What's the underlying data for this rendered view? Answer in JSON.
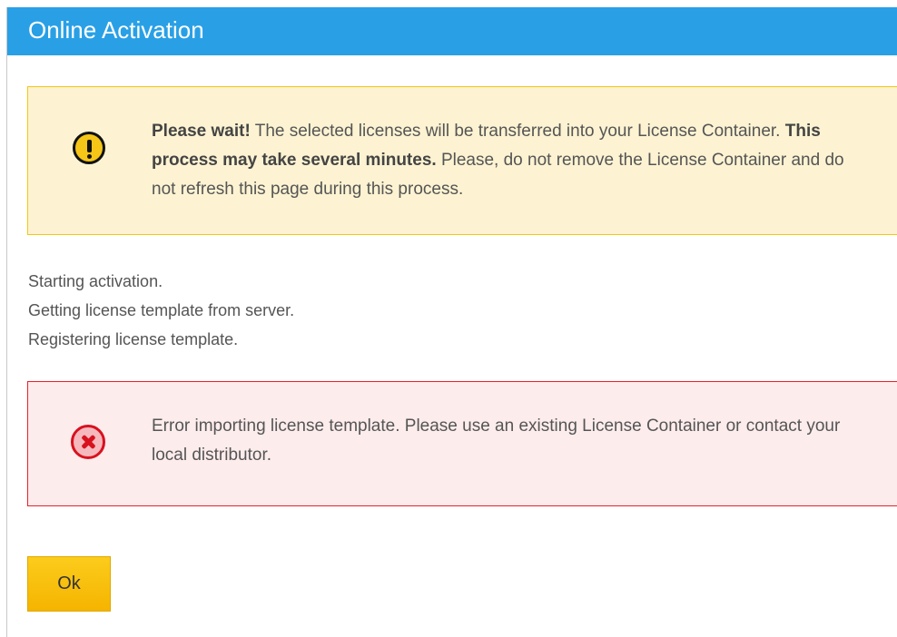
{
  "header": {
    "title": "Online Activation",
    "color": "#29a0e6"
  },
  "warning": {
    "icon": "exclamation-circle-icon",
    "lead": "Please wait!",
    "text1": " The selected licenses will be transferred into your License Container. ",
    "emphasis": "This process may take several minutes.",
    "text2": " Please, do not remove the License Container and do not refresh this page during this process."
  },
  "log": [
    "Starting activation.",
    "Getting license template from server.",
    "Registering license template."
  ],
  "error": {
    "icon": "error-x-circle-icon",
    "text": "Error importing license template. Please use an existing License Container or contact your local distributor."
  },
  "buttons": {
    "ok_label": "Ok"
  }
}
